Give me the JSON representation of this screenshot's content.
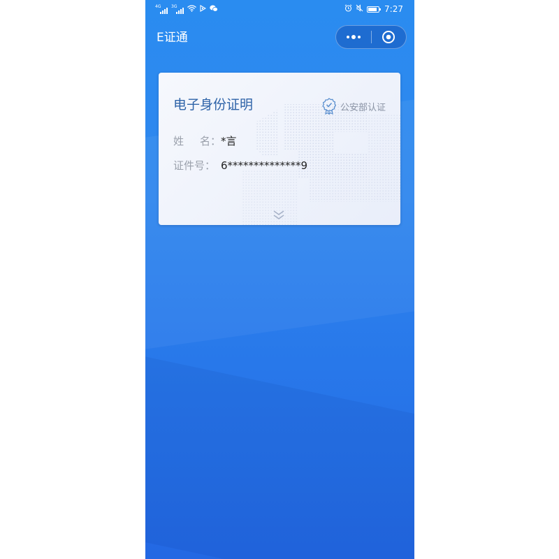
{
  "status_bar": {
    "sim1_tag": "4G",
    "sim2_tag": "3G",
    "time": "7:27"
  },
  "nav": {
    "title": "E证通",
    "more_icon": "more-dots-icon",
    "close_icon": "target-close-icon"
  },
  "card": {
    "title": "电子身份证明",
    "certification": "公安部认证",
    "name_label_1": "姓",
    "name_label_2": "名：",
    "name_value": "*言",
    "id_label": "证件号：",
    "id_value": "6**************9"
  },
  "colors": {
    "background_top": "#2a8cf0",
    "background_bottom": "#2368e3",
    "card_title": "#2e63a8",
    "label_gray": "#9aa0ab"
  }
}
